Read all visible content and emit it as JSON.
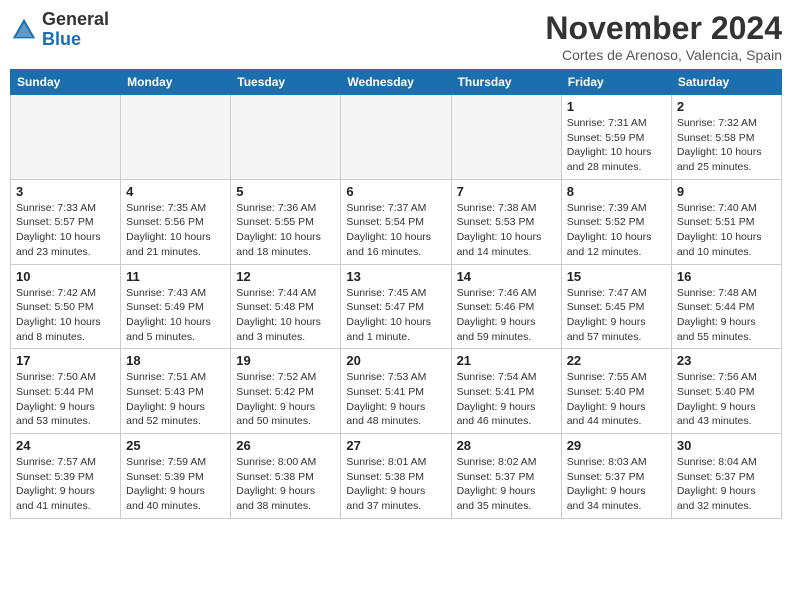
{
  "header": {
    "logo_general": "General",
    "logo_blue": "Blue",
    "month": "November 2024",
    "location": "Cortes de Arenoso, Valencia, Spain"
  },
  "days_of_week": [
    "Sunday",
    "Monday",
    "Tuesday",
    "Wednesday",
    "Thursday",
    "Friday",
    "Saturday"
  ],
  "weeks": [
    [
      {
        "date": "",
        "info": ""
      },
      {
        "date": "",
        "info": ""
      },
      {
        "date": "",
        "info": ""
      },
      {
        "date": "",
        "info": ""
      },
      {
        "date": "",
        "info": ""
      },
      {
        "date": "1",
        "info": "Sunrise: 7:31 AM\nSunset: 5:59 PM\nDaylight: 10 hours\nand 28 minutes."
      },
      {
        "date": "2",
        "info": "Sunrise: 7:32 AM\nSunset: 5:58 PM\nDaylight: 10 hours\nand 25 minutes."
      }
    ],
    [
      {
        "date": "3",
        "info": "Sunrise: 7:33 AM\nSunset: 5:57 PM\nDaylight: 10 hours\nand 23 minutes."
      },
      {
        "date": "4",
        "info": "Sunrise: 7:35 AM\nSunset: 5:56 PM\nDaylight: 10 hours\nand 21 minutes."
      },
      {
        "date": "5",
        "info": "Sunrise: 7:36 AM\nSunset: 5:55 PM\nDaylight: 10 hours\nand 18 minutes."
      },
      {
        "date": "6",
        "info": "Sunrise: 7:37 AM\nSunset: 5:54 PM\nDaylight: 10 hours\nand 16 minutes."
      },
      {
        "date": "7",
        "info": "Sunrise: 7:38 AM\nSunset: 5:53 PM\nDaylight: 10 hours\nand 14 minutes."
      },
      {
        "date": "8",
        "info": "Sunrise: 7:39 AM\nSunset: 5:52 PM\nDaylight: 10 hours\nand 12 minutes."
      },
      {
        "date": "9",
        "info": "Sunrise: 7:40 AM\nSunset: 5:51 PM\nDaylight: 10 hours\nand 10 minutes."
      }
    ],
    [
      {
        "date": "10",
        "info": "Sunrise: 7:42 AM\nSunset: 5:50 PM\nDaylight: 10 hours\nand 8 minutes."
      },
      {
        "date": "11",
        "info": "Sunrise: 7:43 AM\nSunset: 5:49 PM\nDaylight: 10 hours\nand 5 minutes."
      },
      {
        "date": "12",
        "info": "Sunrise: 7:44 AM\nSunset: 5:48 PM\nDaylight: 10 hours\nand 3 minutes."
      },
      {
        "date": "13",
        "info": "Sunrise: 7:45 AM\nSunset: 5:47 PM\nDaylight: 10 hours\nand 1 minute."
      },
      {
        "date": "14",
        "info": "Sunrise: 7:46 AM\nSunset: 5:46 PM\nDaylight: 9 hours\nand 59 minutes."
      },
      {
        "date": "15",
        "info": "Sunrise: 7:47 AM\nSunset: 5:45 PM\nDaylight: 9 hours\nand 57 minutes."
      },
      {
        "date": "16",
        "info": "Sunrise: 7:48 AM\nSunset: 5:44 PM\nDaylight: 9 hours\nand 55 minutes."
      }
    ],
    [
      {
        "date": "17",
        "info": "Sunrise: 7:50 AM\nSunset: 5:44 PM\nDaylight: 9 hours\nand 53 minutes."
      },
      {
        "date": "18",
        "info": "Sunrise: 7:51 AM\nSunset: 5:43 PM\nDaylight: 9 hours\nand 52 minutes."
      },
      {
        "date": "19",
        "info": "Sunrise: 7:52 AM\nSunset: 5:42 PM\nDaylight: 9 hours\nand 50 minutes."
      },
      {
        "date": "20",
        "info": "Sunrise: 7:53 AM\nSunset: 5:41 PM\nDaylight: 9 hours\nand 48 minutes."
      },
      {
        "date": "21",
        "info": "Sunrise: 7:54 AM\nSunset: 5:41 PM\nDaylight: 9 hours\nand 46 minutes."
      },
      {
        "date": "22",
        "info": "Sunrise: 7:55 AM\nSunset: 5:40 PM\nDaylight: 9 hours\nand 44 minutes."
      },
      {
        "date": "23",
        "info": "Sunrise: 7:56 AM\nSunset: 5:40 PM\nDaylight: 9 hours\nand 43 minutes."
      }
    ],
    [
      {
        "date": "24",
        "info": "Sunrise: 7:57 AM\nSunset: 5:39 PM\nDaylight: 9 hours\nand 41 minutes."
      },
      {
        "date": "25",
        "info": "Sunrise: 7:59 AM\nSunset: 5:39 PM\nDaylight: 9 hours\nand 40 minutes."
      },
      {
        "date": "26",
        "info": "Sunrise: 8:00 AM\nSunset: 5:38 PM\nDaylight: 9 hours\nand 38 minutes."
      },
      {
        "date": "27",
        "info": "Sunrise: 8:01 AM\nSunset: 5:38 PM\nDaylight: 9 hours\nand 37 minutes."
      },
      {
        "date": "28",
        "info": "Sunrise: 8:02 AM\nSunset: 5:37 PM\nDaylight: 9 hours\nand 35 minutes."
      },
      {
        "date": "29",
        "info": "Sunrise: 8:03 AM\nSunset: 5:37 PM\nDaylight: 9 hours\nand 34 minutes."
      },
      {
        "date": "30",
        "info": "Sunrise: 8:04 AM\nSunset: 5:37 PM\nDaylight: 9 hours\nand 32 minutes."
      }
    ]
  ]
}
